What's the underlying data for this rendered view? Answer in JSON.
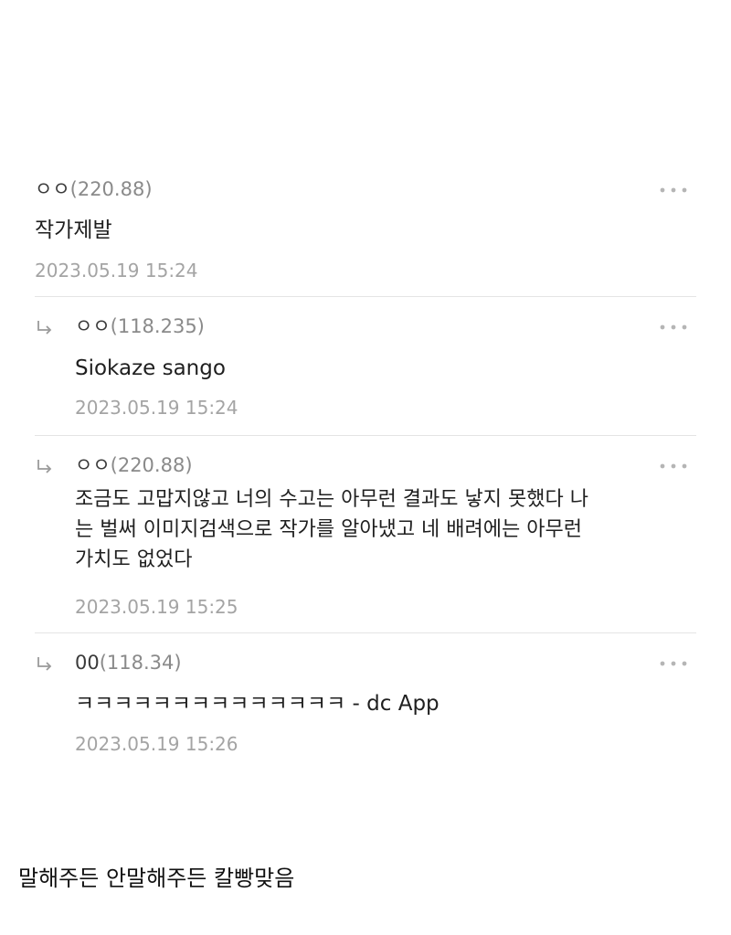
{
  "comments": [
    {
      "nickname": "ㅇㅇ",
      "ip": "(220.88)",
      "text_lines": [
        "작가제발"
      ],
      "date": "2023.05.19 15:24",
      "reply": false
    },
    {
      "nickname": "ㅇㅇ",
      "ip": "(118.235)",
      "text_lines": [
        "Siokaze sango"
      ],
      "date": "2023.05.19 15:24",
      "reply": true
    },
    {
      "nickname": "ㅇㅇ",
      "ip": "(220.88)",
      "text_lines": [
        "조금도 고맙지않고 너의 수고는 아무런 결과도 낳지 못했다 나",
        "는 벌써 이미지검색으로 작가를 알아냈고 네 배려에는 아무런",
        "가치도 없었다"
      ],
      "date": "2023.05.19 15:25",
      "reply": true
    },
    {
      "nickname": "00",
      "ip": "(118.34)",
      "text_lines": [
        "ㅋㅋㅋㅋㅋㅋㅋㅋㅋㅋㅋㅋㅋㅋ - dc App"
      ],
      "date": "2023.05.19 15:26",
      "reply": true
    }
  ],
  "caption": "말해주든 안말해주든 칼빵맞음",
  "icons": {
    "reply": "reply-arrow-icon",
    "more": "more-dots-icon"
  },
  "colors": {
    "text": "#1f1f1f",
    "meta": "#a4a4a4",
    "divider": "#e4e4e4"
  }
}
